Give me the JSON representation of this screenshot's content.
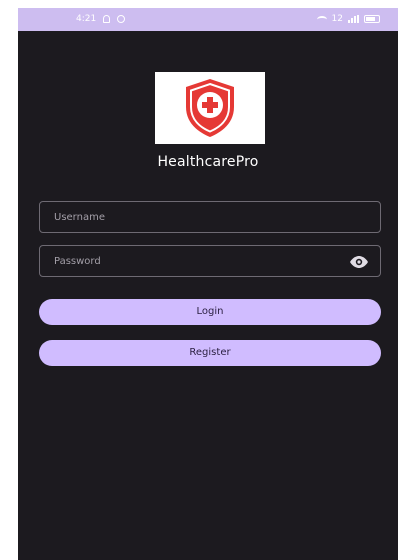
{
  "status_bar": {
    "time": "4:21",
    "network_label": "12",
    "left_icons": [
      "bell-icon",
      "circle-icon"
    ],
    "right_icons": [
      "wifi-icon",
      "signal-icon",
      "battery-icon"
    ]
  },
  "logo": {
    "icon": "shield-medical-cross-icon",
    "shield_color": "#e53935",
    "cross_color": "#ffffff"
  },
  "app": {
    "name": "HealthcarePro"
  },
  "login_form": {
    "username_placeholder": "Username",
    "username_value": "",
    "password_placeholder": "Password",
    "password_value": "",
    "password_toggle_icon": "eye-icon",
    "login_label": "Login",
    "register_label": "Register"
  },
  "colors": {
    "background": "#1c1a1f",
    "status_bar": "#cdbdf0",
    "button": "#d0bcff",
    "field_border": "#6e6a73"
  }
}
